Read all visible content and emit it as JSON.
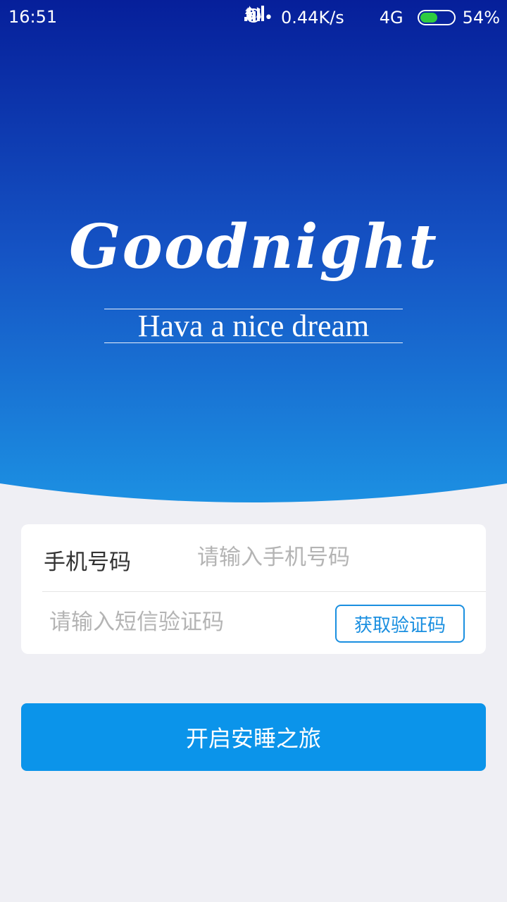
{
  "status_bar": {
    "time": "16:51",
    "dots": "•••",
    "speed": "0.44K/s",
    "network": "4G",
    "battery": "54%",
    "battery_level": 0.54
  },
  "logo": {
    "title": "Goodnight",
    "tagline": "Hava a nice dream"
  },
  "form": {
    "phone_label": "手机号码",
    "phone_placeholder": "请输入手机号码",
    "code_placeholder": "请输入短信验证码",
    "get_code_label": "获取验证码"
  },
  "start_button": "开启安睡之旅",
  "colors": {
    "hero_top": "#0a2b9c",
    "hero_bottom": "#1e8fe0",
    "accent": "#0b94ea",
    "background": "#efeff4"
  }
}
